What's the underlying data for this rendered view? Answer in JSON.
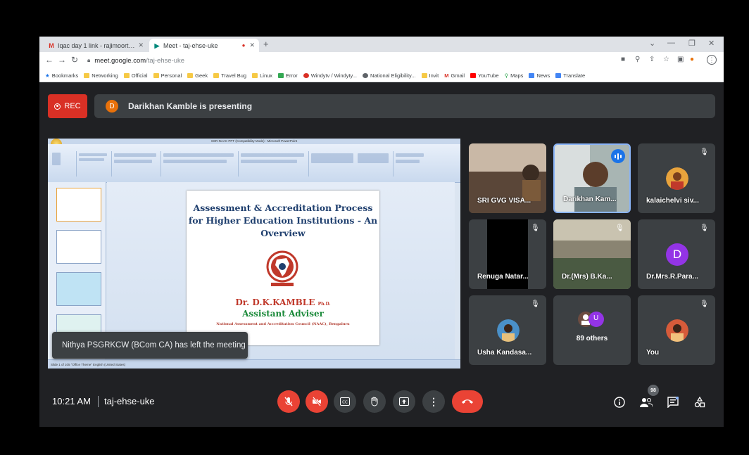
{
  "browser": {
    "tabs": [
      {
        "label": "Iqac day 1 link - rajimoorthy020...",
        "icon": "gmail-icon",
        "active": false
      },
      {
        "label": "Meet - taj-ehse-uke",
        "icon": "meet-icon",
        "active": true
      }
    ],
    "url_host": "meet.google.com",
    "url_path": "/taj-ehse-uke",
    "bookmarks": [
      "Bookmarks",
      "Networking",
      "Official",
      "Personal",
      "Geek",
      "Travel Bug",
      "Linux",
      "Error",
      "Windytv / Windyty...",
      "National Eligibility...",
      "Invit",
      "Gmail",
      "YouTube",
      "Maps",
      "News",
      "Translate"
    ]
  },
  "meet": {
    "rec_label": "REC",
    "presenter_initial": "D",
    "presenting_text": "Darikhan Kamble is presenting",
    "toast": "Nithya PSGRKCW (BCom CA) has left the meeting",
    "time": "10:21 AM",
    "meeting_code": "taj-ehse-uke",
    "participants_count": "98",
    "tiles": [
      {
        "name": "SRI GVG VISA...",
        "type": "video"
      },
      {
        "name": "Darikhan Kam...",
        "type": "video",
        "speaking": true
      },
      {
        "name": "kalaichelvi siv...",
        "type": "avatar",
        "muted": true
      },
      {
        "name": "Renuga Natar...",
        "type": "video",
        "muted": true
      },
      {
        "name": "Dr.(Mrs) B.Ka...",
        "type": "video",
        "muted": true
      },
      {
        "name": "Dr.Mrs.R.Para...",
        "type": "letter",
        "letter": "D",
        "muted": true
      },
      {
        "name": "Usha Kandasa...",
        "type": "avatar",
        "muted": true
      },
      {
        "name": "89 others",
        "type": "group",
        "letter": "U"
      },
      {
        "name": "You",
        "type": "avatar",
        "muted": true
      }
    ]
  },
  "presentation": {
    "window_title": "SSR-NAAC PPT (Compatibility Mode) - Microsoft PowerPoint",
    "slide_title_lines": [
      "Assessment & Accreditation Process",
      "for Higher Education Institutions - An",
      "Overview"
    ],
    "name": "Dr. D.K.KAMBLE",
    "name_suffix": "Ph.D.",
    "role": "Assistant Adviser",
    "org": "National Assessment and Accreditation Council (NAAC), Bengaluru",
    "status": "Slide 1 of 105   \"Office Theme\"   English (United States)"
  },
  "colors": {
    "meet_bg": "#202124",
    "tile_bg": "#3c4043",
    "danger": "#ea4335",
    "speaking": "#1a73e8",
    "slide_title": "#1f3f6e",
    "slide_name": "#c0392b",
    "slide_role": "#1b8a3a"
  }
}
